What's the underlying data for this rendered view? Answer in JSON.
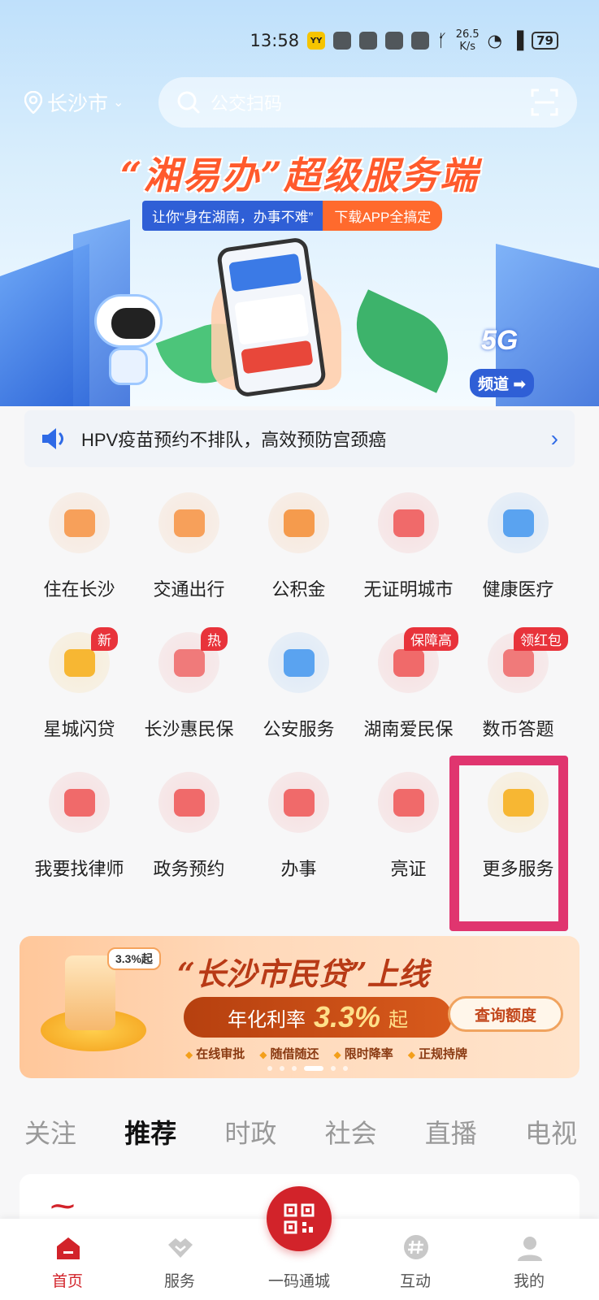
{
  "status_bar": {
    "time": "13:58",
    "speed_value": "26.5",
    "speed_unit": "K/s",
    "battery": "79"
  },
  "header": {
    "city": "长沙市",
    "search_placeholder": "公交扫码"
  },
  "banner": {
    "title": "“湘易办”超级服务端",
    "subtitle": "让你“身在湖南，办事不难”",
    "cta": "下载APP全搞定",
    "fiveg": "5G",
    "fiveg_channel": "频道"
  },
  "notice": {
    "text": "HPV疫苗预约不排队，高效预防宫颈癌"
  },
  "services": [
    {
      "label": "住在长沙",
      "icon": "wallet-icon",
      "color": "#f7a05a",
      "badge": ""
    },
    {
      "label": "交通出行",
      "icon": "car-icon",
      "color": "#f7a05a",
      "badge": ""
    },
    {
      "label": "公积金",
      "icon": "yuan-house-icon",
      "color": "#f59b4d",
      "badge": ""
    },
    {
      "label": "无证明城市",
      "icon": "id-phone-icon",
      "color": "#f06a6a",
      "badge": ""
    },
    {
      "label": "健康医疗",
      "icon": "medkit-icon",
      "color": "#5aa3f0",
      "badge": ""
    },
    {
      "label": "星城闪贷",
      "icon": "money-bag-icon",
      "color": "#f7b733",
      "badge": "新"
    },
    {
      "label": "长沙惠民保",
      "icon": "shield-doc-icon",
      "color": "#f07a7a",
      "badge": "热"
    },
    {
      "label": "公安服务",
      "icon": "police-badge-icon",
      "color": "#5aa3f0",
      "badge": ""
    },
    {
      "label": "湖南爱民保",
      "icon": "heart-hands-icon",
      "color": "#f06a6a",
      "badge": "保障高"
    },
    {
      "label": "数币答题",
      "icon": "digital-coin-icon",
      "color": "#f07a7a",
      "badge": "领红包"
    },
    {
      "label": "我要找律师",
      "icon": "lawyer-icon",
      "color": "#f06a6a",
      "badge": ""
    },
    {
      "label": "政务预约",
      "icon": "clock-icon",
      "color": "#f06a6a",
      "badge": ""
    },
    {
      "label": "办事",
      "icon": "bookmark-icon",
      "color": "#f06a6a",
      "badge": ""
    },
    {
      "label": "亮证",
      "icon": "card-icon",
      "color": "#f06a6a",
      "badge": ""
    },
    {
      "label": "更多服务",
      "icon": "four-petal-icon",
      "color": "#f7b733",
      "badge": ""
    }
  ],
  "loan_banner": {
    "tag": "3.3%起",
    "title": "“长沙市民贷”上线",
    "rate_label": "年化利率",
    "rate_value": "3.3%",
    "rate_suffix": "起",
    "query_button": "查询额度",
    "features": [
      "在线审批",
      "随借随还",
      "限时降率",
      "正规持牌"
    ]
  },
  "news_tabs": [
    "关注",
    "推荐",
    "时政",
    "社会",
    "直播",
    "电视"
  ],
  "active_tab": "推荐",
  "bottom_nav": [
    {
      "label": "首页",
      "icon": "home-icon",
      "active": true
    },
    {
      "label": "服务",
      "icon": "handshake-icon",
      "active": false
    },
    {
      "label": "一码通城",
      "icon": "qr-code-icon",
      "active": false
    },
    {
      "label": "互动",
      "icon": "hashtag-bubble-icon",
      "active": false
    },
    {
      "label": "我的",
      "icon": "user-icon",
      "active": false
    }
  ],
  "colors": {
    "brand_red": "#d2232a",
    "highlight": "#e0356f",
    "accent_blue": "#2f6ae6"
  }
}
